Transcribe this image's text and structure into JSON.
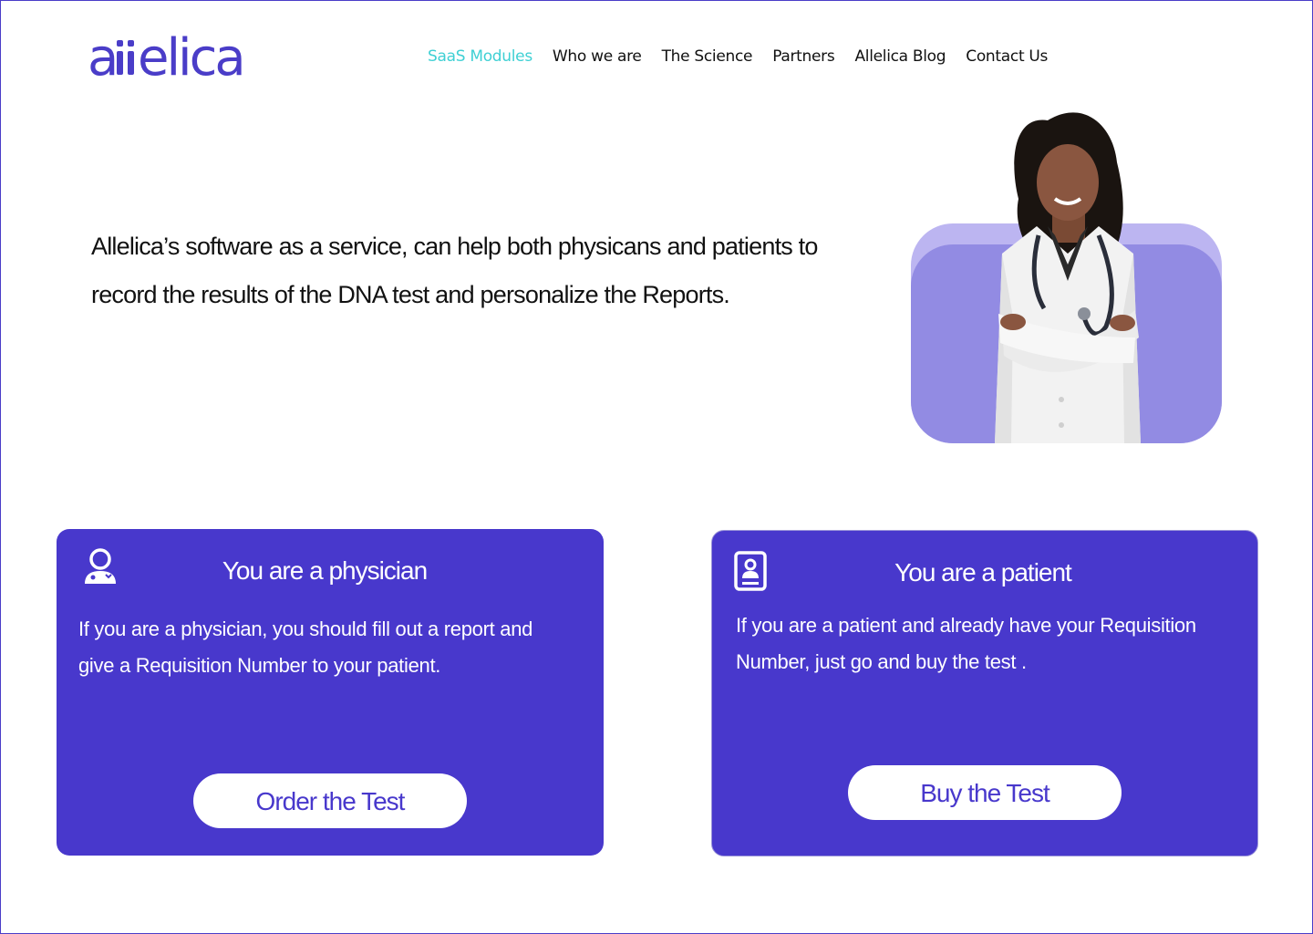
{
  "header": {
    "logo_text": "allelica",
    "nav": [
      {
        "label": "SaaS Modules",
        "active": true
      },
      {
        "label": "Who we are",
        "active": false
      },
      {
        "label": "The Science",
        "active": false
      },
      {
        "label": "Partners",
        "active": false
      },
      {
        "label": "Allelica Blog",
        "active": false
      },
      {
        "label": "Contact Us",
        "active": false
      }
    ]
  },
  "hero": {
    "line1": "Allelica’s software as a service, can help both physicans and patients to",
    "line2": "record the results of the DNA test and personalize the Reports."
  },
  "cards": {
    "physician": {
      "icon": "doctor-icon",
      "title": "You are a physician",
      "desc_line1": "If you are a physician, you should fill out a report and",
      "desc_line2": "give a Requisition Number to your patient.",
      "button": "Order the Test"
    },
    "patient": {
      "icon": "patient-id-card-icon",
      "title": "You are a patient",
      "desc_line1": "If you are a patient and already have your Requisition",
      "desc_line2": "Number, just go and buy the test .",
      "button": "Buy the Test"
    }
  },
  "colors": {
    "brand": "#4838cc",
    "nav_active": "#3fd0d4",
    "hero_shape_light": "#bcb5f1",
    "hero_shape_dark": "#928be3"
  }
}
